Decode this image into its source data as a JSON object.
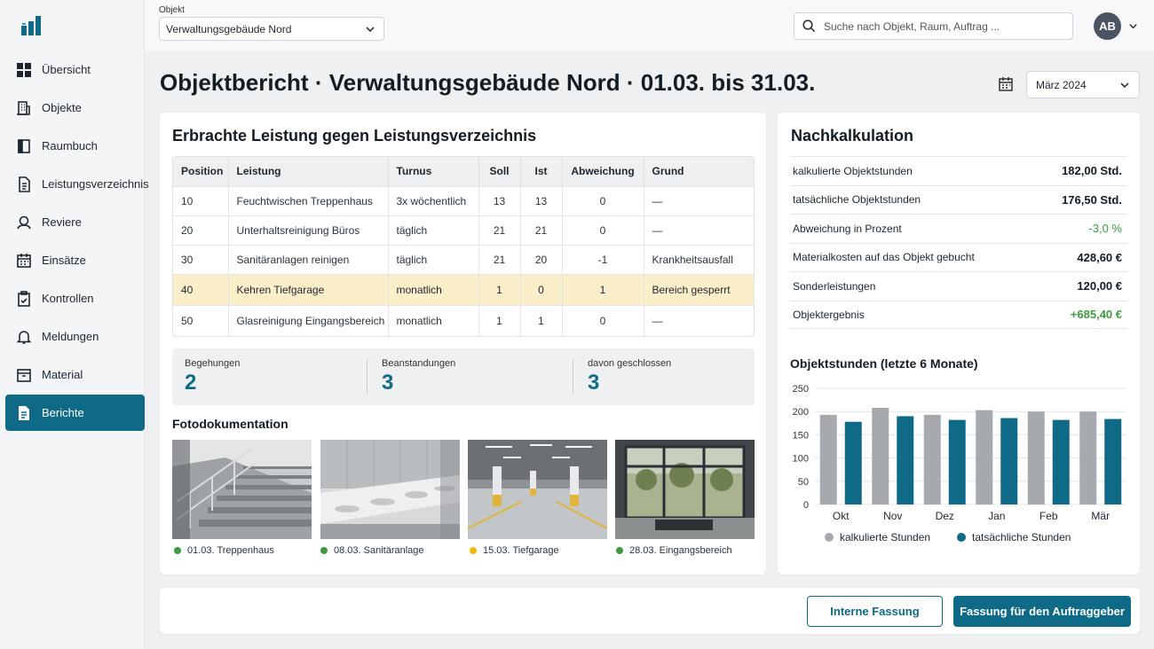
{
  "sidebar": {
    "items": [
      {
        "label": "Übersicht",
        "icon": "grid-icon"
      },
      {
        "label": "Objekte",
        "icon": "building-icon"
      },
      {
        "label": "Raumbuch",
        "icon": "book-icon"
      },
      {
        "label": "Leistungsverzeichnis",
        "icon": "document-icon"
      },
      {
        "label": "Reviere",
        "icon": "location-icon"
      },
      {
        "label": "Einsätze",
        "icon": "calendar-icon"
      },
      {
        "label": "Kontrollen",
        "icon": "clipboard-check-icon"
      },
      {
        "label": "Meldungen",
        "icon": "bell-icon"
      },
      {
        "label": "Material",
        "icon": "box-icon"
      },
      {
        "label": "Berichte",
        "icon": "report-icon"
      }
    ],
    "active": "Berichte"
  },
  "topbar": {
    "object_label": "Objekt",
    "object_value": "Verwaltungsgebäude Nord",
    "search_placeholder": "Suche nach Objekt, Raum, Auftrag ...",
    "avatar_initials": "AB"
  },
  "page": {
    "title": "Objektbericht · Verwaltungsgebäude Nord · 01.03. bis 31.03.",
    "month": "März 2024"
  },
  "leistung": {
    "title": "Erbrachte Leistung gegen Leistungsverzeichnis",
    "columns": [
      "Position",
      "Leistung",
      "Turnus",
      "Soll",
      "Ist",
      "Abweichung",
      "Grund"
    ],
    "rows": [
      {
        "pos": "10",
        "leistung": "Feuchtwischen Treppenhaus",
        "turnus": "3x wöchentlich",
        "soll": "13",
        "ist": "13",
        "abw": "0",
        "grund": "—"
      },
      {
        "pos": "20",
        "leistung": "Unterhaltsreinigung Büros",
        "turnus": "täglich",
        "soll": "21",
        "ist": "21",
        "abw": "0",
        "grund": "—"
      },
      {
        "pos": "30",
        "leistung": "Sanitäranlagen reinigen",
        "turnus": "täglich",
        "soll": "21",
        "ist": "20",
        "abw": "-1",
        "grund": "Krankheitsausfall"
      },
      {
        "pos": "40",
        "leistung": "Kehren Tiefgarage",
        "turnus": "monatlich",
        "soll": "1",
        "ist": "0",
        "abw": "1",
        "grund": "Bereich gesperrt"
      },
      {
        "pos": "50",
        "leistung": "Glasreinigung Eingangsbereich",
        "turnus": "monatlich",
        "soll": "1",
        "ist": "1",
        "abw": "0",
        "grund": "—"
      }
    ],
    "highlight_color": "#fbefc9"
  },
  "stats": [
    {
      "label": "Begehungen",
      "value": "2"
    },
    {
      "label": "Beanstandungen",
      "value": "3"
    },
    {
      "label": "davon geschlossen",
      "value": "3"
    }
  ],
  "fotos": {
    "title": "Fotodokumentation",
    "items": [
      {
        "caption": "01.03. Treppenhaus",
        "status_color": "#3c9a3f"
      },
      {
        "caption": "08.03. Sanitäranlage",
        "status_color": "#3c9a3f"
      },
      {
        "caption": "15.03. Tiefgarage",
        "status_color": "#f2b705"
      },
      {
        "caption": "28.03. Eingangsbereich",
        "status_color": "#3c9a3f"
      }
    ]
  },
  "nachkalkulation": {
    "title": "Nachkalkulation",
    "rows": [
      {
        "label": "kalkulierte Objektstunden",
        "value": "182,00 Std."
      },
      {
        "label": "tatsächliche Objektstunden",
        "value": "176,50 Std."
      },
      {
        "label": "Abweichung in Prozent",
        "value": "-3,0 %"
      },
      {
        "label": "Materialkosten auf das Objekt gebucht",
        "value": "428,60 €"
      },
      {
        "label": "Sonderleistungen",
        "value": "120,00 €"
      },
      {
        "label": "Objektergebnis",
        "value": "+685,40 €"
      }
    ]
  },
  "chart_data": {
    "type": "bar",
    "title": "Objektstunden (letzte 6 Monate)",
    "categories": [
      "Okt",
      "Nov",
      "Dez",
      "Jan",
      "Feb",
      "Mär"
    ],
    "series": [
      {
        "name": "kalkulierte Stunden",
        "values": [
          193,
          208,
          193,
          203,
          200,
          200
        ],
        "color": "#a6a9ad"
      },
      {
        "name": "tatsächliche Stunden",
        "values": [
          178,
          190,
          182,
          186,
          182,
          184
        ],
        "color": "#0f6a87"
      }
    ],
    "yticks": [
      0,
      50,
      100,
      150,
      200,
      250
    ],
    "ylim": [
      0,
      250
    ],
    "grid": true,
    "legend": "bottom"
  },
  "actions": {
    "internal": "Interne Fassung",
    "client": "Fassung für den Auftraggeber"
  },
  "colors": {
    "accent": "#0f6a87",
    "positive": "#3c9a3f"
  }
}
